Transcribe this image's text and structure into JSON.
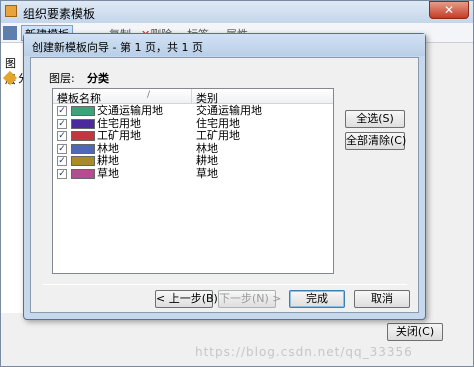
{
  "outer_window": {
    "title": "组织要素模板",
    "close_glyph": "✕",
    "toolbar": {
      "new_template": "新建模板",
      "copy": "复制",
      "delete": "删除",
      "delete_glyph": "✕",
      "label": "标签",
      "attribute": "属性"
    },
    "left_panel": {
      "layer_label": "图层",
      "tree_item": "分"
    },
    "close_button": "关闭(C)"
  },
  "wizard": {
    "title": "创建新模板向导 - 第 1 页，共 1 页",
    "layer_label": "图层:",
    "layer_value": "分类",
    "list": {
      "columns": [
        "模板名称",
        "类别"
      ],
      "sort_glyph": "/",
      "check_glyph": "✓",
      "rows": [
        {
          "name": "交通运输用地",
          "category": "交通运输用地",
          "color": "#3aa37a",
          "checked": true
        },
        {
          "name": "住宅用地",
          "category": "住宅用地",
          "color": "#4a2a9c",
          "checked": true
        },
        {
          "name": "工矿用地",
          "category": "工矿用地",
          "color": "#c2363f",
          "checked": true
        },
        {
          "name": "林地",
          "category": "林地",
          "color": "#4f68b5",
          "checked": true
        },
        {
          "name": "耕地",
          "category": "耕地",
          "color": "#a88a2c",
          "checked": true
        },
        {
          "name": "草地",
          "category": "草地",
          "color": "#b64b92",
          "checked": true
        }
      ]
    },
    "buttons": {
      "select_all": "全选(S)",
      "clear_all": "全部清除(C)",
      "prev": "< 上一步(B)",
      "next": "下一步(N) >",
      "finish": "完成",
      "cancel": "取消"
    }
  },
  "watermark": "https://blog.csdn.net/qq_33356"
}
